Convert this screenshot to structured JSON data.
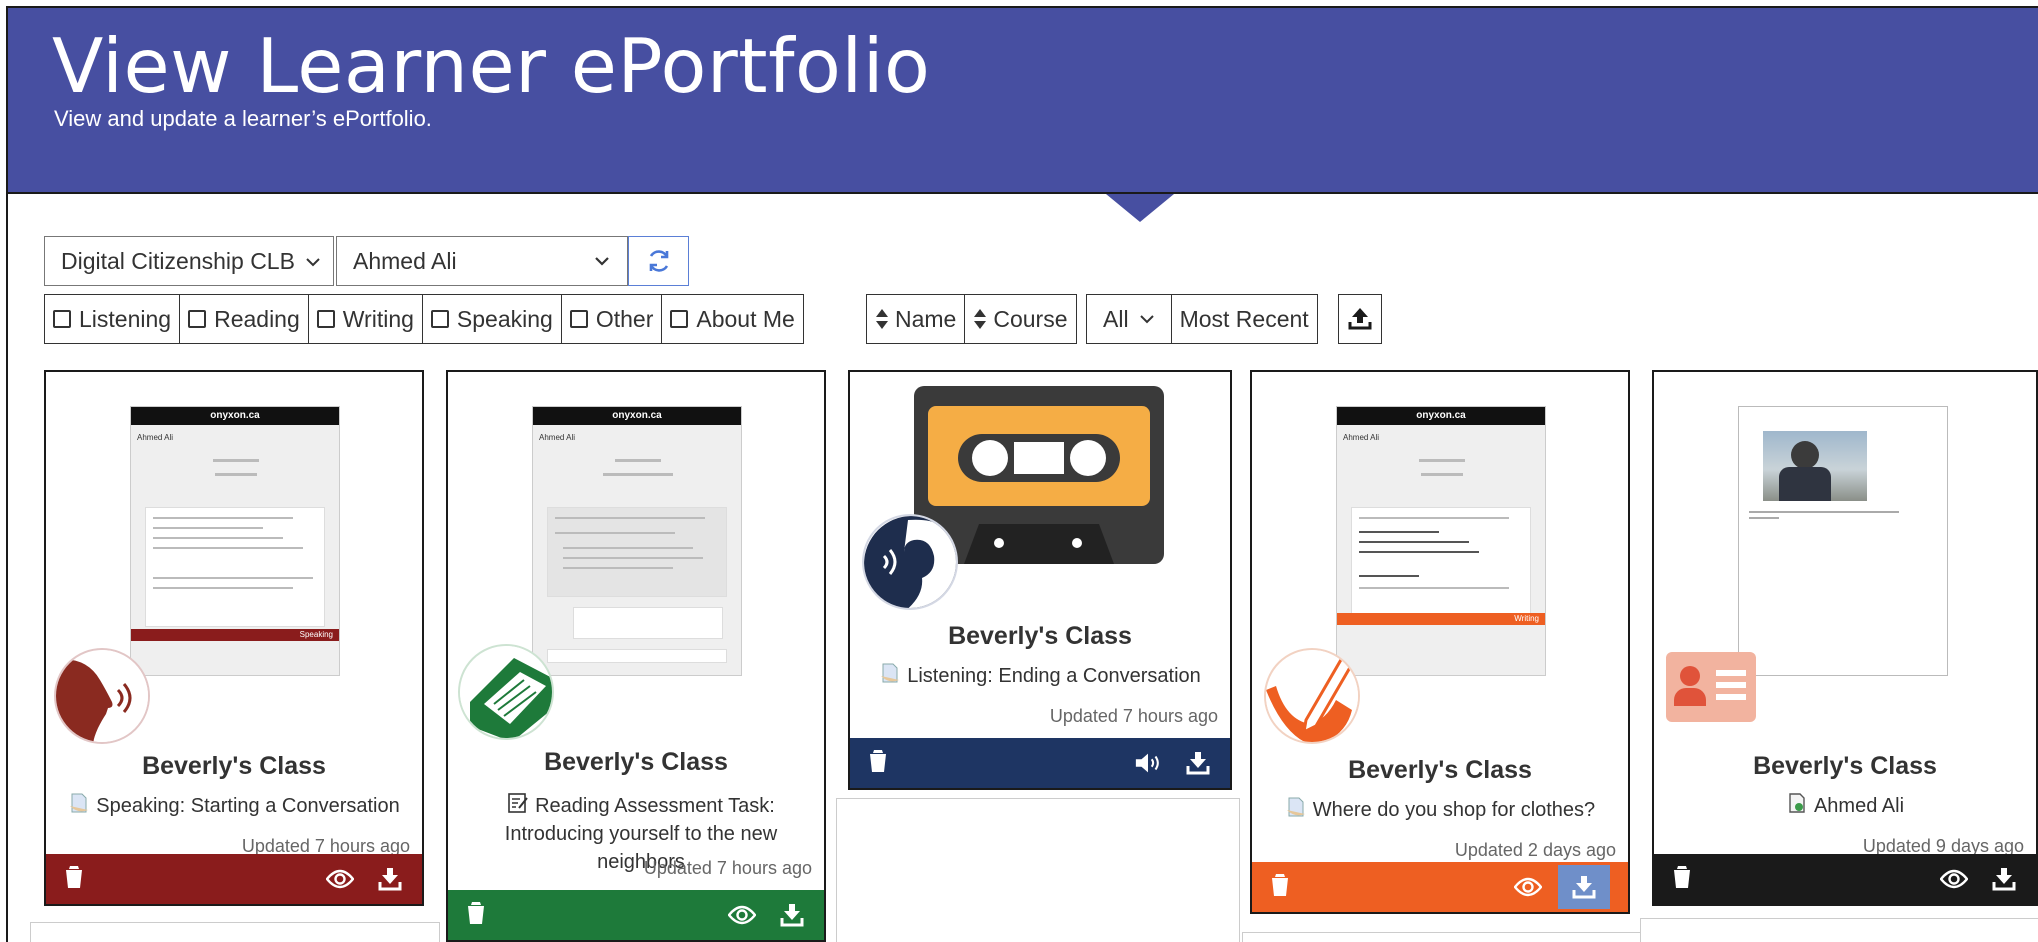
{
  "header": {
    "title": "View Learner ePortfolio",
    "subtitle": "View and update a learner’s ePortfolio."
  },
  "filters": {
    "course_value": "Digital Citizenship CLB",
    "learner_value": "Ahmed Ali",
    "skills": [
      "Listening",
      "Reading",
      "Writing",
      "Speaking",
      "Other",
      "About Me"
    ],
    "sort_name": "Name",
    "sort_course": "Course",
    "scope": "All",
    "order": "Most Recent"
  },
  "cards": [
    {
      "title": "Beverly's Class",
      "description": "Speaking: Starting a Conversation",
      "updated": "Updated 7 hours ago",
      "thumb_brand": "onyxon.ca",
      "thumb_name": "Ahmed Ali",
      "thumb_tag": "Speaking",
      "icon": "speaking-icon",
      "bar_color": "#8a1c1c"
    },
    {
      "title": "Beverly's Class",
      "description": "Reading Assessment Task: Introducing yourself to the new neighbors",
      "updated": "Updated 7 hours ago",
      "thumb_brand": "onyxon.ca",
      "thumb_name": "Ahmed Ali",
      "icon": "reading-icon",
      "bar_color": "#1e7a3a"
    },
    {
      "title": "Beverly's Class",
      "description": "Listening: Ending a Conversation",
      "updated": "Updated 7 hours ago",
      "icon": "listening-icon",
      "bar_color": "#1e3563"
    },
    {
      "title": "Beverly's Class",
      "description": "Where do you shop for clothes?",
      "updated": "Updated 2 days ago",
      "thumb_brand": "onyxon.ca",
      "thumb_name": "Ahmed Ali",
      "thumb_tag": "Writing",
      "icon": "writing-icon",
      "bar_color": "#ee5f22"
    },
    {
      "title": "Beverly's Class",
      "description": "Ahmed Ali",
      "updated": "Updated 9 days ago",
      "icon": "about-me-icon",
      "bar_color": "#1a1a1a"
    }
  ]
}
